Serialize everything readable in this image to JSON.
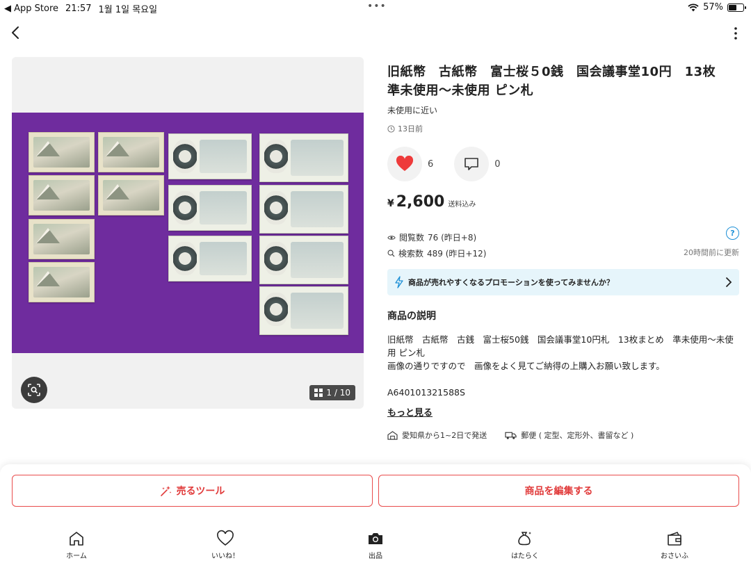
{
  "status_bar": {
    "back_app": "◀ App Store",
    "time": "21:57",
    "date": "1월 1일 목요일",
    "dots": "•••",
    "battery": "57%",
    "battery_level": 0.57
  },
  "gallery": {
    "counter": "1 / 10"
  },
  "product": {
    "title": "旧紙幣　古紙幣　富士桜５0銭　国会議事堂10円　13枚　準未使用～未使用 ピン札",
    "condition": "未使用に近い",
    "posted": "13日前",
    "likes": "6",
    "comments": "0",
    "price_symbol": "¥",
    "price": "2,600",
    "shipping_included": "送料込み"
  },
  "stats": {
    "views_label": "閲覧数",
    "views": "76 (昨日+8)",
    "search_label": "検索数",
    "search": "489 (昨日+12)",
    "help": "?",
    "updated": "20時間前に更新"
  },
  "promo": {
    "text": "商品が売れやすくなるプロモーションを使ってみませんか？"
  },
  "description": {
    "heading": "商品の説明",
    "body": "旧紙幣　古紙幣　古銭　富士桜50銭　国会議事堂10円札　13枚まとめ　準未使用～未使用 ピン札\n画像の通りですので　画像をよく見てご納得の上購入お願い致します。",
    "code": "A640101321588S",
    "more": "もっと見る"
  },
  "shipping": {
    "origin": "愛知県から1~2日で発送",
    "method": "郵便 ( 定型、定形外、書留など )"
  },
  "buttons": {
    "sell_tool": "売るツール",
    "edit": "商品を編集する"
  },
  "tabs": [
    {
      "label": "ホーム",
      "icon": "home-icon"
    },
    {
      "label": "いいね！",
      "icon": "heart-icon"
    },
    {
      "label": "出品",
      "icon": "camera-icon"
    },
    {
      "label": "はたらく",
      "icon": "bag-icon"
    },
    {
      "label": "おさいふ",
      "icon": "wallet-icon"
    }
  ],
  "colors": {
    "accent": "#e13b3b",
    "heart": "#ee3b3b",
    "promo_bg": "#e6f5fb",
    "help": "#1c8fd6",
    "photo_bg": "#6f2c9e"
  }
}
